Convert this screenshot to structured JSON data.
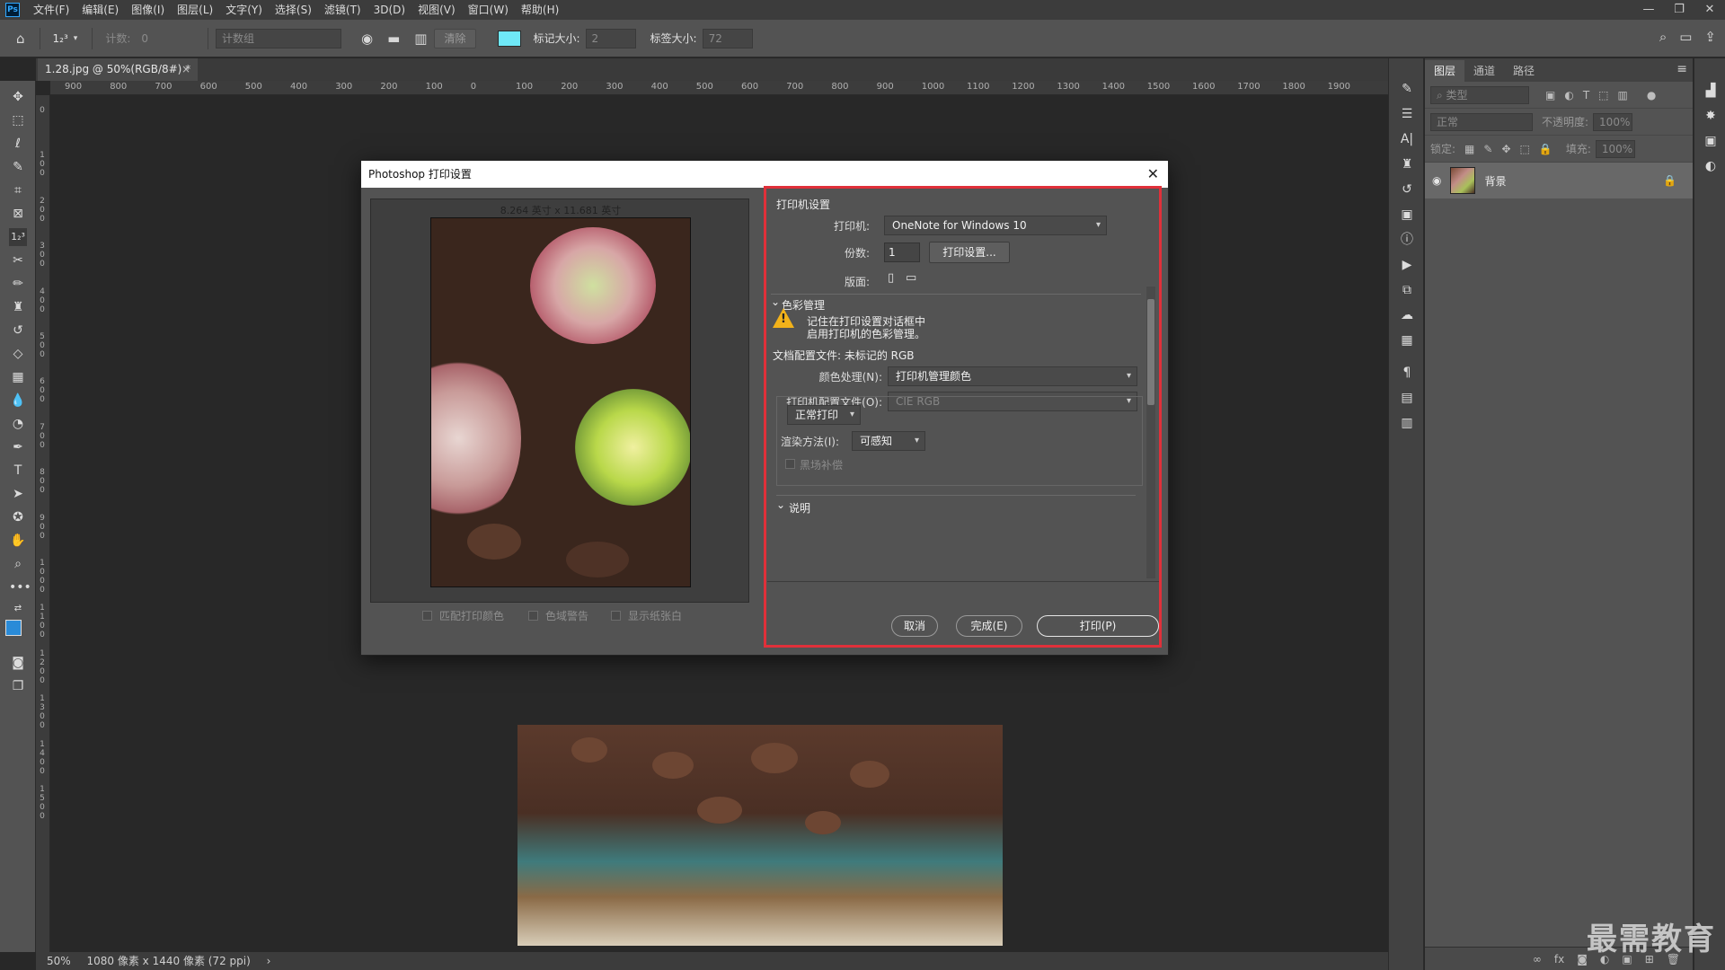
{
  "menubar": {
    "items": [
      "文件(F)",
      "编辑(E)",
      "图像(I)",
      "图层(L)",
      "文字(Y)",
      "选择(S)",
      "滤镜(T)",
      "3D(D)",
      "视图(V)",
      "窗口(W)",
      "帮助(H)"
    ],
    "logo": "Ps",
    "window_controls": [
      "—",
      "❐",
      "✕"
    ]
  },
  "optbar": {
    "tool_label": "1₂³",
    "count_label": "计数:",
    "count_value": "0",
    "count_group": "计数组",
    "clear_label": "清除",
    "marker_size_label": "标记大小:",
    "marker_size_value": "2",
    "label_size_label": "标签大小:",
    "label_size_value": "72",
    "swatch_color": "#6fe8f7"
  },
  "document": {
    "tab_title": "1.28.jpg @ 50%(RGB/8#) *",
    "tab_close": "×"
  },
  "ruler_top": [
    "900",
    "800",
    "700",
    "600",
    "500",
    "400",
    "300",
    "200",
    "100",
    "0",
    "100",
    "200",
    "300",
    "400",
    "500",
    "600",
    "700",
    "800",
    "900",
    "1000",
    "1100",
    "1200",
    "1300",
    "1400",
    "1500",
    "1600",
    "1700",
    "1800",
    "1900"
  ],
  "ruler_left": [
    "0",
    "1 0 0",
    "2 0 0",
    "3 0 0",
    "4 0 0",
    "5 0 0",
    "6 0 0",
    "7 0 0",
    "8 0 0",
    "9 0 0",
    "1 0 0 0",
    "1 1 0 0",
    "1 2 0 0",
    "1 3 0 0",
    "1 4 0 0",
    "1 5 0 0"
  ],
  "statusbar": {
    "zoom": "50%",
    "dimensions": "1080 像素 x 1440 像素 (72 ppi)",
    "arrow": "›"
  },
  "panel": {
    "tabs": [
      "图层",
      "通道",
      "路径"
    ],
    "menu_icon": "≡",
    "filter_kind": "类型",
    "blend_mode": "正常",
    "opacity_label": "不透明度:",
    "opacity_value": "100%",
    "lock_label": "锁定:",
    "fill_label": "填充:",
    "fill_value": "100%",
    "layer_name": "背景",
    "bottom_icons": [
      "∞",
      "fx",
      "◙",
      "◐",
      "▣",
      "⊞",
      "🗑"
    ]
  },
  "watermark": "最需教育",
  "dialog": {
    "title": "Photoshop 打印设置",
    "close": "✕",
    "size_label": "8.264 英寸 x 11.681 英寸",
    "preview_options": [
      "匹配打印颜色",
      "色域警告",
      "显示纸张白"
    ],
    "printer_section": "打印机设置",
    "printer_label": "打印机:",
    "printer_value": "OneNote for Windows 10",
    "copies_label": "份数:",
    "copies_value": "1",
    "print_setup_button": "打印设置...",
    "layout_label": "版面:",
    "color_section": "色彩管理",
    "warning_line1": "记住在打印设置对话框中",
    "warning_line2": "启用打印机的色彩管理。",
    "doc_profile": "文档配置文件: 未标记的 RGB",
    "color_handling_label": "颜色处理(N):",
    "color_handling_value": "打印机管理颜色",
    "printer_profile_label": "打印机配置文件(O):",
    "printer_profile_value": "CIE RGB",
    "print_mode_value": "正常打印",
    "render_label": "渲染方法(I):",
    "render_value": "可感知",
    "black_point": "黑场补偿",
    "description_section": "说明",
    "cancel_button": "取消",
    "done_button": "完成(E)",
    "print_button": "打印(P)",
    "highlight_color": "#e0303a"
  }
}
